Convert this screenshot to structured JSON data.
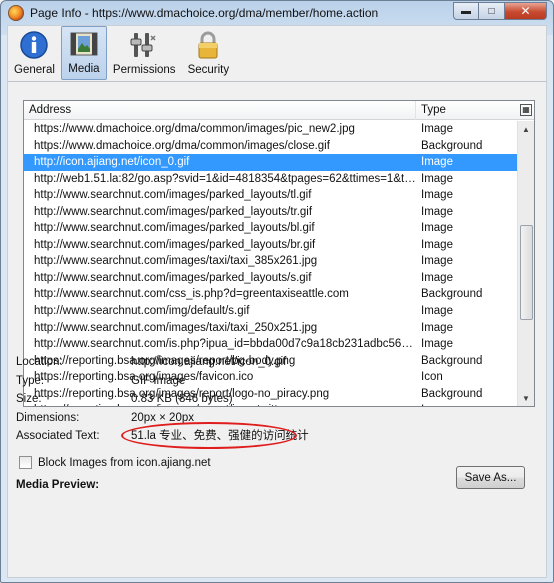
{
  "window": {
    "title": "Page Info - https://www.dmachoice.org/dma/member/home.action"
  },
  "toolbar": {
    "tabs": [
      {
        "label": "General",
        "icon": "info-icon"
      },
      {
        "label": "Media",
        "icon": "media-icon"
      },
      {
        "label": "Permissions",
        "icon": "permissions-icon"
      },
      {
        "label": "Security",
        "icon": "lock-icon"
      }
    ],
    "active_tab": "Media"
  },
  "media_list": {
    "columns": {
      "address": "Address",
      "type": "Type"
    },
    "rows": [
      {
        "address": "https://www.dmachoice.org/dma/common/images/pic_new2.jpg",
        "type": "Image"
      },
      {
        "address": "https://www.dmachoice.org/dma/common/images/close.gif",
        "type": "Background"
      },
      {
        "address": "http://icon.ajiang.net/icon_0.gif",
        "type": "Image",
        "selected": true
      },
      {
        "address": "http://web1.51.la:82/go.asp?svid=1&id=4818354&tpages=62&ttimes=1&tz...",
        "type": "Image"
      },
      {
        "address": "http://www.searchnut.com/images/parked_layouts/tl.gif",
        "type": "Image"
      },
      {
        "address": "http://www.searchnut.com/images/parked_layouts/tr.gif",
        "type": "Image"
      },
      {
        "address": "http://www.searchnut.com/images/parked_layouts/bl.gif",
        "type": "Image"
      },
      {
        "address": "http://www.searchnut.com/images/parked_layouts/br.gif",
        "type": "Image"
      },
      {
        "address": "http://www.searchnut.com/images/taxi/taxi_385x261.jpg",
        "type": "Image"
      },
      {
        "address": "http://www.searchnut.com/images/parked_layouts/s.gif",
        "type": "Image"
      },
      {
        "address": "http://www.searchnut.com/css_is.php?d=greentaxiseattle.com",
        "type": "Background"
      },
      {
        "address": "http://www.searchnut.com/img/default/s.gif",
        "type": "Image"
      },
      {
        "address": "http://www.searchnut.com/images/taxi/taxi_250x251.jpg",
        "type": "Image"
      },
      {
        "address": "http://www.searchnut.com/is.php?ipua_id=bbda00d7c9a18cb231adbc56b1e...",
        "type": "Image"
      },
      {
        "address": "https://reporting.bsa.org/images/report/bg-body.png",
        "type": "Background"
      },
      {
        "address": "https://reporting.bsa.org/images/favicon.ico",
        "type": "Icon"
      },
      {
        "address": "https://reporting.bsa.org/images/report/logo-no_piracy.png",
        "type": "Background"
      },
      {
        "address": "https://reporting.bsa.org/images/report/icon-twitter.png",
        "type": "Image"
      }
    ]
  },
  "details": {
    "location": {
      "label": "Location:",
      "value": "http://icon.ajiang.net/icon_0.gif"
    },
    "type": {
      "label": "Type:",
      "value": "GIF Image"
    },
    "size": {
      "label": "Size:",
      "value": "0.83 KB (846 bytes)"
    },
    "dimensions": {
      "label": "Dimensions:",
      "value": "20px × 20px"
    },
    "associated_text": {
      "label": "Associated Text:",
      "value": "51.la 专业、免费、强健的访问统计"
    }
  },
  "block_images": {
    "label": "Block Images from icon.ajiang.net",
    "checked": false
  },
  "media_preview_label": "Media Preview:",
  "save_as_label": "Save As...",
  "colors": {
    "selection": "#3399ff",
    "highlight_ring": "#e01d1d"
  }
}
